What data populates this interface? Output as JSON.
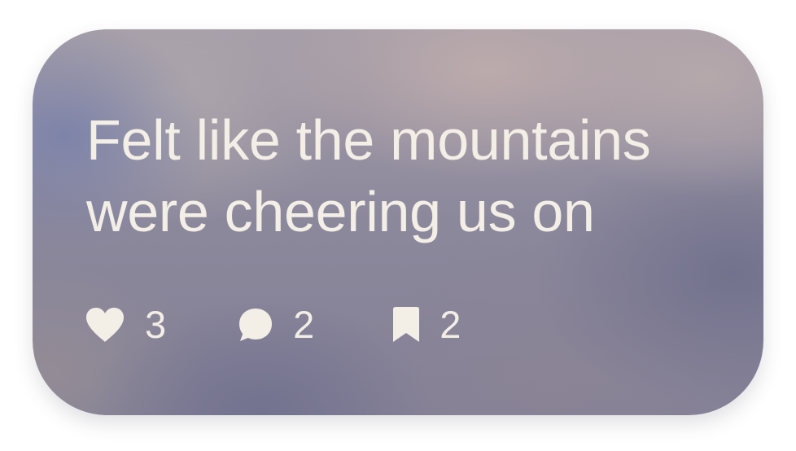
{
  "post": {
    "text_line1": "Felt like the mountains",
    "text_line2": "were cheering us on"
  },
  "stats": {
    "likes": {
      "icon": "heart-icon",
      "count": "3"
    },
    "comments": {
      "icon": "speech-bubble-icon",
      "count": "2"
    },
    "saves": {
      "icon": "bookmark-icon",
      "count": "2"
    }
  },
  "colors": {
    "text": "#f3eee6",
    "card_base": "#8c889c"
  }
}
